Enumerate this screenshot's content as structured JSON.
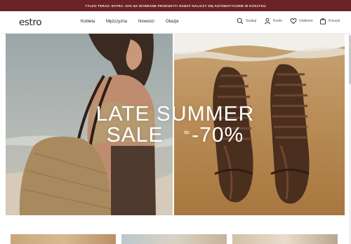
{
  "promo": {
    "text": "TYLKO TERAZ: EXTRA -10% NA WYBRANE PRODUKTY! RABAT NALICZY SIĘ AUTOMATYCZNIE W KOSZYKU"
  },
  "header": {
    "logo": "estro",
    "nav": [
      "Kobieta",
      "Mężczyzna",
      "Nowości",
      "Okazje"
    ],
    "utilities": {
      "search": "Szukaj",
      "account": "Konto",
      "wishlist": "Ulubione",
      "cart": "Koszyk"
    }
  },
  "hero": {
    "line1": "LATE SUMMER",
    "line2_prefix": "SALE",
    "upto": "do",
    "discount": "-70%"
  },
  "colors": {
    "promo_bg": "#6b2226",
    "promo_text": "#f3e7e4",
    "hero_text": "#ffffff"
  },
  "icons": {
    "search": "search-icon",
    "account": "user-icon",
    "wishlist": "heart-icon",
    "cart": "bag-icon"
  }
}
